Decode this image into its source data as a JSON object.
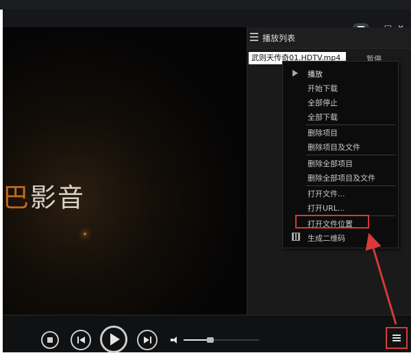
{
  "window": {
    "controls": [
      "–",
      "□",
      "✕"
    ]
  },
  "video": {
    "logo_part_orange": "巴",
    "logo_part_white": "影音"
  },
  "playlist": {
    "title": "播放列表",
    "item": {
      "name": "武则天传奇01.HDTV.mp4",
      "status": "暂停"
    }
  },
  "context_menu": {
    "items": [
      "播放",
      "开始下载",
      "全部停止",
      "全部下载",
      "删除项目",
      "删除项目及文件",
      "删除全部项目",
      "删除全部项目及文件",
      "打开文件...",
      "打开URL...",
      "打开文件位置",
      "生成二维码"
    ],
    "highlighted": "打开文件位置"
  },
  "controls": {
    "volume_level": 0.35
  },
  "colors": {
    "highlight": "#d93a3a",
    "logo_orange": "#c36a1c"
  }
}
